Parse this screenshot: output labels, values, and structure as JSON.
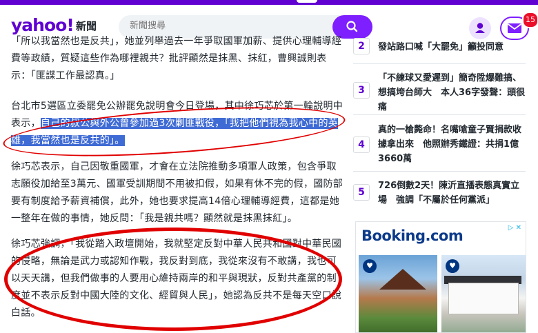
{
  "header": {
    "logo": "yahoo!",
    "logo_section": "新聞",
    "search_placeholder": "新聞搜尋",
    "mail_badge": "15"
  },
  "article": {
    "paragraphs": [
      {
        "text": "「所以我當然也是反共」，她並列舉過去一年爭取國軍加薪、提供心理輔導經費等政績，質疑這些作為哪裡親共？批評顯然是抹黑、抹紅，曹興誠則表示：「匪諜工作最認真。」"
      },
      {
        "text_before": "台北市5選區立委罷免公辦罷免說明會今日登場，其中徐巧芯於第一輪說明中表示，",
        "text_highlight": "自己的叔公與外公曾參加過3次剿匪戰役，「我把他們視為我心中的英雄，我當然也是反共的」。"
      },
      {
        "text": "徐巧芯表示，自己因敬重國軍，才會在立法院推動多項軍人政策，包含爭取志願役加給至3萬元、國軍受訓期間不用被扣假，如果有休不完的假，國防部要有制度給予薪資補償，此外，她也要求提高14倍心理輔導經費，這都是她一整年在做的事情，她反問：「我是親共嗎？顯然就是抹黑抹紅」。"
      },
      {
        "text": "徐巧芯強調，「我從踏入政壇開始，我就堅定反對中華人民共和國對中華民國的侵略，無論是武力或認知作戰，我反對到底，我從來沒有不敢講，我也可以天天講，但我們做事的人要用心維持兩岸的和平與現狀，反對共產黨的制度並不表示反對中國大陸的文化、經貿與人民」，她認為反共不是每天空口說白話。"
      }
    ]
  },
  "sidebar": {
    "trending": [
      {
        "rank": "2",
        "title": "發站路口喊「大罷免」籲投同意"
      },
      {
        "rank": "3",
        "title": "「不練球又愛遲到」簡奇陞爆難搞、想搞垮台師大　本人36字發聲：頭很痛"
      },
      {
        "rank": "4",
        "title": "真的一槍斃命！名嘴嗆童子賢捐款收據拿出來　他照辦秀鐵證：共捐1億3660萬"
      },
      {
        "rank": "5",
        "title": "726倒數2天！陳沂直播表態真實立場　強調「不屬於任何黨派」"
      }
    ]
  },
  "ad": {
    "brand": "Booking.com",
    "ad_icons": "▷ ✕",
    "heart_icon": "♥"
  },
  "colors": {
    "brand_purple": "#6001d2",
    "highlight_blue": "#3f6bd4",
    "annotation_red": "#e10000",
    "booking_blue": "#003580"
  }
}
